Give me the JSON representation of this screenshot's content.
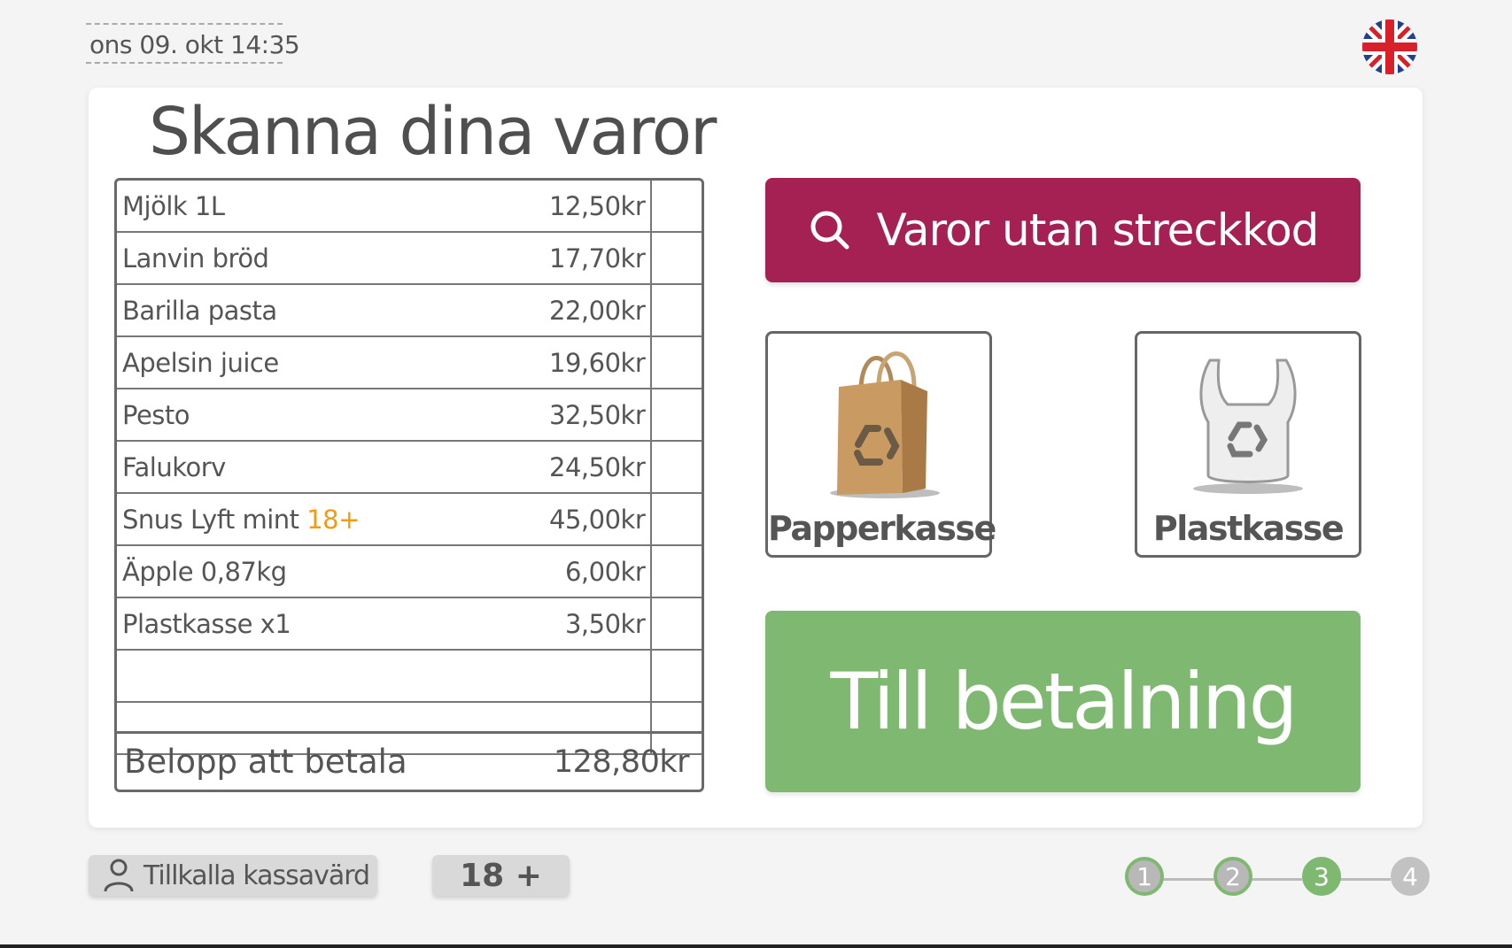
{
  "header": {
    "datetime": "ons 09. okt  14:35",
    "language_icon": "uk-flag-icon"
  },
  "main": {
    "title": "Skanna dina varor"
  },
  "receipt": {
    "items": [
      {
        "name": "Mjölk 1L",
        "price": "12,50kr"
      },
      {
        "name": "Lanvin bröd",
        "price": "17,70kr"
      },
      {
        "name": "Barilla pasta",
        "price": "22,00kr"
      },
      {
        "name": "Apelsin juice",
        "price": "19,60kr"
      },
      {
        "name": "Pesto",
        "price": "32,50kr"
      },
      {
        "name": "Falukorv",
        "price": "24,50kr"
      },
      {
        "name": "Snus Lyft mint",
        "age_badge": "18+",
        "price": "45,00kr"
      },
      {
        "name": "Äpple 0,87kg",
        "price": "6,00kr"
      },
      {
        "name": "Plastkasse x1",
        "price": "3,50kr"
      },
      {
        "name": "",
        "price": ""
      },
      {
        "name": "",
        "price": ""
      }
    ],
    "total_label": "Belopp att betala",
    "total_value": "128,80kr"
  },
  "actions": {
    "lookup_label": "Varor utan streckkod",
    "paper_bag_label": "Papperkasse",
    "plastic_bag_label": "Plastkasse",
    "pay_label": "Till betalning"
  },
  "footer": {
    "call_attendant_label": "Tillkalla kassavärd",
    "age_label": "18 +",
    "steps": [
      "1",
      "2",
      "3",
      "4"
    ],
    "current_step": 3
  },
  "colors": {
    "lookup": "#a52154",
    "pay": "#7fb870",
    "age_badge": "#f39c12"
  }
}
